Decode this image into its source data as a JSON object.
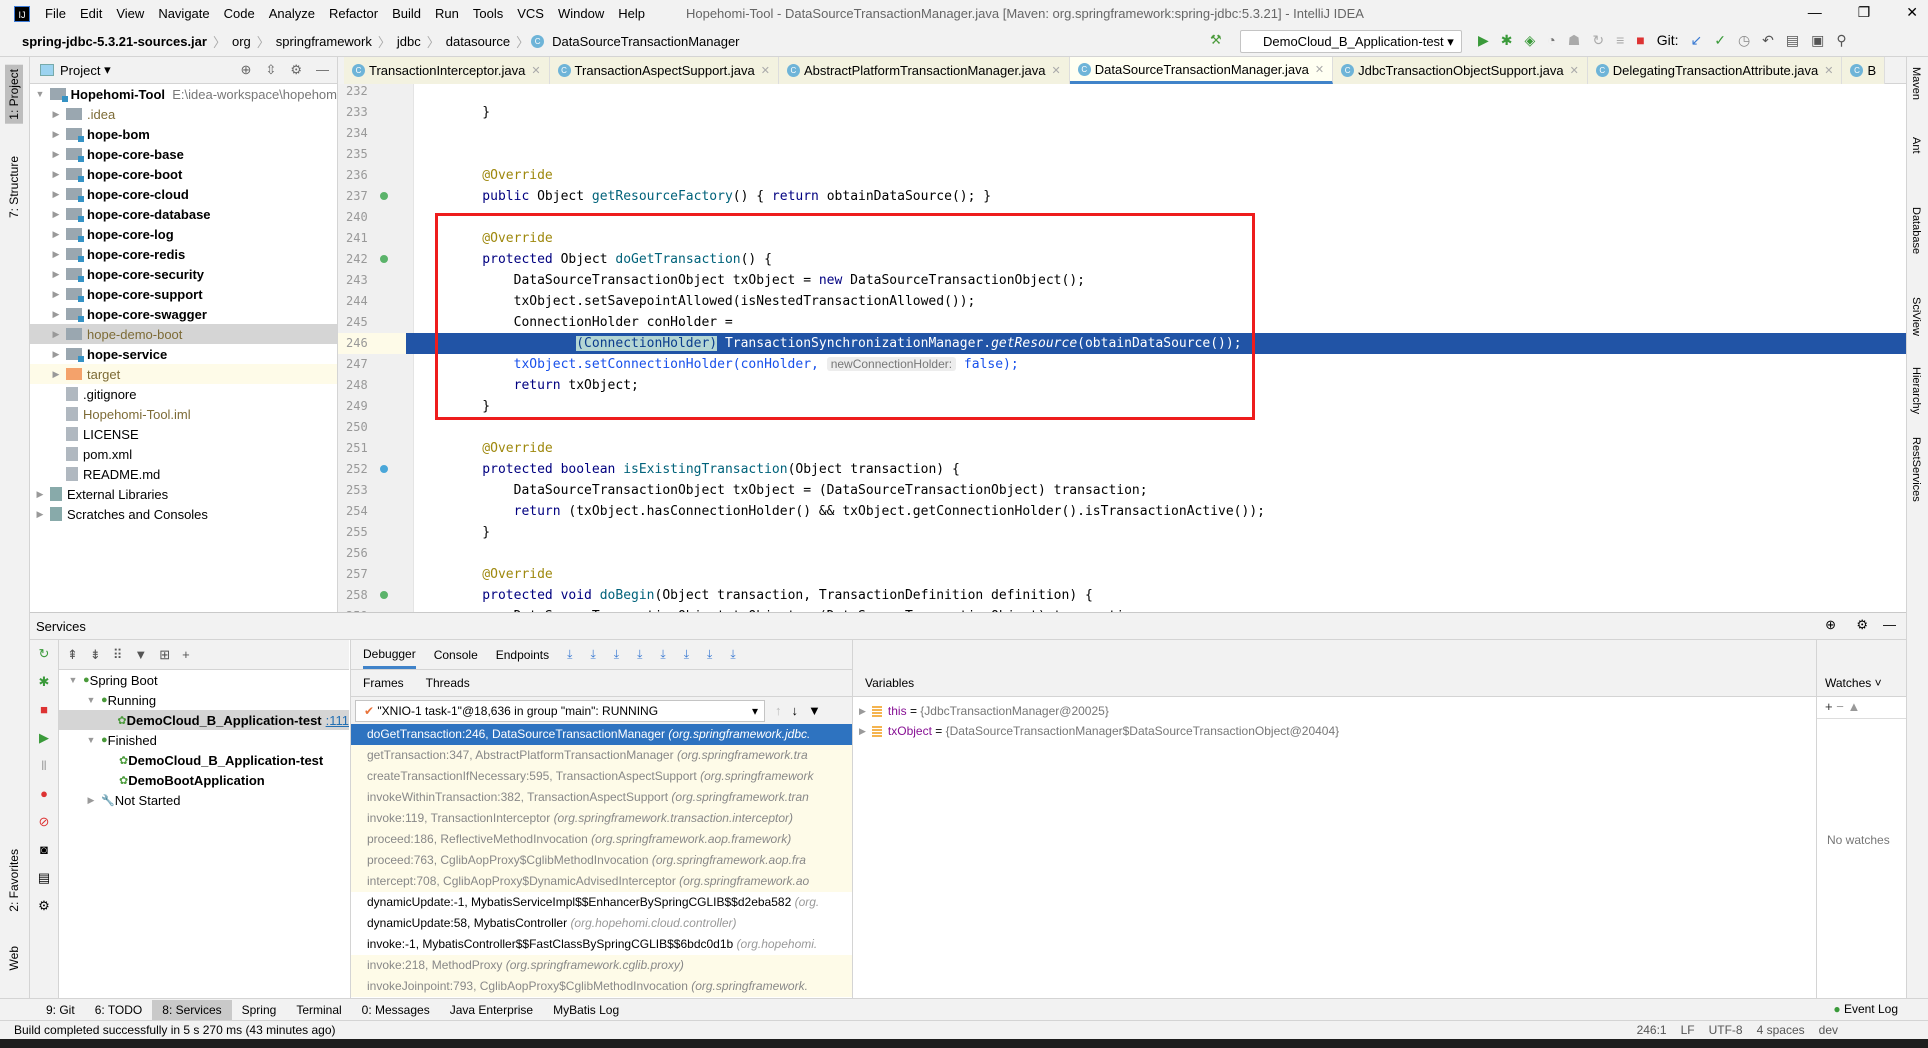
{
  "menu": {
    "title": "Hopehomi-Tool - DataSourceTransactionManager.java [Maven: org.springframework:spring-jdbc:5.3.21] - IntelliJ IDEA",
    "items": [
      "File",
      "Edit",
      "View",
      "Navigate",
      "Code",
      "Analyze",
      "Refactor",
      "Build",
      "Run",
      "Tools",
      "VCS",
      "Window",
      "Help"
    ]
  },
  "breadcrumb": [
    "spring-jdbc-5.3.21-sources.jar",
    "org",
    "springframework",
    "jdbc",
    "datasource",
    "DataSourceTransactionManager"
  ],
  "run_config": "DemoCloud_B_Application-test",
  "git_label": "Git:",
  "left_stripe": [
    "1: Project",
    "7: Structure",
    "2: Favorites",
    "Web"
  ],
  "right_stripe": [
    "Maven",
    "Ant",
    "Database",
    "SciView",
    "Hierarchy",
    "RestServices"
  ],
  "project": {
    "title": "Project",
    "root": {
      "name": "Hopehomi-Tool",
      "path": "E:\\idea-workspace\\hopehom"
    },
    "items": [
      {
        "name": ".idea",
        "kind": "folder"
      },
      {
        "name": "hope-bom",
        "kind": "module"
      },
      {
        "name": "hope-core-base",
        "kind": "module"
      },
      {
        "name": "hope-core-boot",
        "kind": "module"
      },
      {
        "name": "hope-core-cloud",
        "kind": "module"
      },
      {
        "name": "hope-core-database",
        "kind": "module"
      },
      {
        "name": "hope-core-log",
        "kind": "module"
      },
      {
        "name": "hope-core-redis",
        "kind": "module"
      },
      {
        "name": "hope-core-security",
        "kind": "module"
      },
      {
        "name": "hope-core-support",
        "kind": "module"
      },
      {
        "name": "hope-core-swagger",
        "kind": "module"
      },
      {
        "name": "hope-demo-boot",
        "kind": "selected"
      },
      {
        "name": "hope-service",
        "kind": "module"
      },
      {
        "name": "target",
        "kind": "target"
      },
      {
        "name": ".gitignore",
        "kind": "file"
      },
      {
        "name": "Hopehomi-Tool.iml",
        "kind": "iml"
      },
      {
        "name": "LICENSE",
        "kind": "file"
      },
      {
        "name": "pom.xml",
        "kind": "file"
      },
      {
        "name": "README.md",
        "kind": "file"
      }
    ],
    "extra": [
      "External Libraries",
      "Scratches and Consoles"
    ]
  },
  "tabs": [
    "TransactionInterceptor.java",
    "TransactionAspectSupport.java",
    "AbstractPlatformTransactionManager.java",
    "DataSourceTransactionManager.java",
    "JdbcTransactionObjectSupport.java",
    "DelegatingTransactionAttribute.java",
    "B"
  ],
  "active_tab": 3,
  "code": [
    {
      "n": "232",
      "t": []
    },
    {
      "n": "233",
      "t": [
        [
          "    }",
          ""
        ]
      ]
    },
    {
      "n": "234",
      "t": []
    },
    {
      "n": "235",
      "t": []
    },
    {
      "n": "236",
      "t": [
        [
          "    @Override",
          "ann"
        ]
      ]
    },
    {
      "n": "237",
      "g": "green",
      "t": [
        [
          "    public ",
          "kw"
        ],
        [
          "Object ",
          ""
        ],
        [
          "getResourceFactory",
          "fn"
        ],
        [
          "() { ",
          ""
        ],
        [
          "return ",
          "kw"
        ],
        [
          "obtainDataSource(); }",
          ""
        ]
      ]
    },
    {
      "n": "240",
      "t": []
    },
    {
      "n": "241",
      "t": [
        [
          "    @Override",
          "ann"
        ]
      ]
    },
    {
      "n": "242",
      "g": "green",
      "t": [
        [
          "    protected ",
          "kw"
        ],
        [
          "Object ",
          ""
        ],
        [
          "doGetTransaction",
          "fn"
        ],
        [
          "() {",
          ""
        ]
      ]
    },
    {
      "n": "243",
      "t": [
        [
          "        DataSourceTransactionObject txObject = ",
          ""
        ],
        [
          "new ",
          "kw"
        ],
        [
          "DataSourceTransactionObject();",
          ""
        ]
      ]
    },
    {
      "n": "244",
      "t": [
        [
          "        txObject.setSavepointAllowed(isNestedTransactionAllowed());",
          ""
        ]
      ]
    },
    {
      "n": "245",
      "t": [
        [
          "        ConnectionHolder conHolder =",
          ""
        ]
      ]
    },
    {
      "n": "246",
      "hl": true,
      "t": [
        [
          "                ",
          ""
        ],
        [
          "(ConnectionHolder)",
          "brk"
        ],
        [
          " TransactionSynchronizationManager.",
          ""
        ],
        [
          "getResource",
          "it"
        ],
        [
          "(obtainDataSource());",
          ""
        ]
      ]
    },
    {
      "n": "247",
      "t": [
        [
          "        txObject.setConnectionHolder(conHolder, ",
          "call"
        ],
        [
          "newConnectionHolder:",
          "hint"
        ],
        [
          " false);",
          "call"
        ]
      ]
    },
    {
      "n": "248",
      "t": [
        [
          "        return ",
          "kw"
        ],
        [
          "txObject;",
          ""
        ]
      ]
    },
    {
      "n": "249",
      "t": [
        [
          "    }",
          ""
        ]
      ]
    },
    {
      "n": "250",
      "t": []
    },
    {
      "n": "251",
      "t": [
        [
          "    @Override",
          "ann"
        ]
      ]
    },
    {
      "n": "252",
      "g": "blue",
      "t": [
        [
          "    protected ",
          "kw"
        ],
        [
          "boolean ",
          "kw"
        ],
        [
          "isExistingTransaction",
          "fn"
        ],
        [
          "(Object transaction) {",
          ""
        ]
      ]
    },
    {
      "n": "253",
      "t": [
        [
          "        DataSourceTransactionObject txObject = (DataSourceTransactionObject) transaction;",
          ""
        ]
      ]
    },
    {
      "n": "254",
      "t": [
        [
          "        return ",
          "kw"
        ],
        [
          "(txObject.hasConnectionHolder() && txObject.getConnectionHolder().isTransactionActive());",
          ""
        ]
      ]
    },
    {
      "n": "255",
      "t": [
        [
          "    }",
          ""
        ]
      ]
    },
    {
      "n": "256",
      "t": []
    },
    {
      "n": "257",
      "t": [
        [
          "    @Override",
          "ann"
        ]
      ]
    },
    {
      "n": "258",
      "g": "green",
      "t": [
        [
          "    protected ",
          "kw"
        ],
        [
          "void ",
          "kw"
        ],
        [
          "doBegin",
          "fn"
        ],
        [
          "(Object transaction, TransactionDefinition definition) {",
          ""
        ]
      ]
    },
    {
      "n": "259",
      "t": [
        [
          "        DataSourceTransactionObject txObject = (DataSourceTransactionObject) transaction;",
          ""
        ]
      ]
    }
  ],
  "services": {
    "title": "Services",
    "tree": [
      {
        "label": "Spring Boot",
        "lvl": 0,
        "arrow": "▼"
      },
      {
        "label": "Running",
        "lvl": 1,
        "arrow": "▼"
      },
      {
        "label": "DemoCloud_B_Application-test",
        "lvl": 2,
        "bold": true,
        "sel": true,
        "port": ":111"
      },
      {
        "label": "Finished",
        "lvl": 1,
        "arrow": "▼"
      },
      {
        "label": "DemoCloud_B_Application-test",
        "lvl": 2,
        "bold": true
      },
      {
        "label": "DemoBootApplication",
        "lvl": 2,
        "bold": true
      },
      {
        "label": "Not Started",
        "lvl": 1,
        "arrow": "▶"
      }
    ],
    "debug_tabs": [
      "Debugger",
      "Console",
      "Endpoints"
    ],
    "frame_tabs": [
      "Frames",
      "Threads"
    ],
    "thread": "\"XNIO-1 task-1\"@18,636 in group \"main\": RUNNING",
    "frames": [
      {
        "m": "doGetTransaction:246, DataSourceTransactionManager",
        "p": "(org.springframework.jdbc.",
        "s": "sel"
      },
      {
        "m": "getTransaction:347, AbstractPlatformTransactionManager",
        "p": "(org.springframework.tra",
        "s": "lib"
      },
      {
        "m": "createTransactionIfNecessary:595, TransactionAspectSupport",
        "p": "(org.springframework",
        "s": "lib"
      },
      {
        "m": "invokeWithinTransaction:382, TransactionAspectSupport",
        "p": "(org.springframework.tran",
        "s": "lib"
      },
      {
        "m": "invoke:119, TransactionInterceptor",
        "p": "(org.springframework.transaction.interceptor)",
        "s": "lib"
      },
      {
        "m": "proceed:186, ReflectiveMethodInvocation",
        "p": "(org.springframework.aop.framework)",
        "s": "lib"
      },
      {
        "m": "proceed:763, CglibAopProxy$CglibMethodInvocation",
        "p": "(org.springframework.aop.fra",
        "s": "lib"
      },
      {
        "m": "intercept:708, CglibAopProxy$DynamicAdvisedInterceptor",
        "p": "(org.springframework.ao",
        "s": "lib"
      },
      {
        "m": "dynamicUpdate:-1, MybatisServiceImpl$$EnhancerBySpringCGLIB$$d2eba582",
        "p": "(org.",
        "s": "user"
      },
      {
        "m": "dynamicUpdate:58, MybatisController",
        "p": "(org.hopehomi.cloud.controller)",
        "s": "user"
      },
      {
        "m": "invoke:-1, MybatisController$$FastClassBySpringCGLIB$$6bdc0d1b",
        "p": "(org.hopehomi.",
        "s": "user"
      },
      {
        "m": "invoke:218, MethodProxy",
        "p": "(org.springframework.cglib.proxy)",
        "s": "lib"
      },
      {
        "m": "invokeJoinpoint:793, CglibAopProxy$CglibMethodInvocation",
        "p": "(org.springframework.",
        "s": "lib"
      }
    ],
    "variables_title": "Variables",
    "variables": [
      {
        "name": "this",
        "value": "{JdbcTransactionManager@20025}"
      },
      {
        "name": "txObject",
        "value": "{DataSourceTransactionManager$DataSourceTransactionObject@20404}"
      }
    ],
    "watches_title": "Watches",
    "no_watches": "No watches"
  },
  "toolwindows": [
    "9: Git",
    "6: TODO",
    "8: Services",
    "Spring",
    "Terminal",
    "0: Messages",
    "Java Enterprise",
    "MyBatis Log"
  ],
  "event_log": "Event Log",
  "status": {
    "message": "Build completed successfully in 5 s 270 ms (43 minutes ago)",
    "position": "246:1",
    "line_sep": "LF",
    "encoding": "UTF-8",
    "indent": "4 spaces",
    "branch": "dev"
  }
}
